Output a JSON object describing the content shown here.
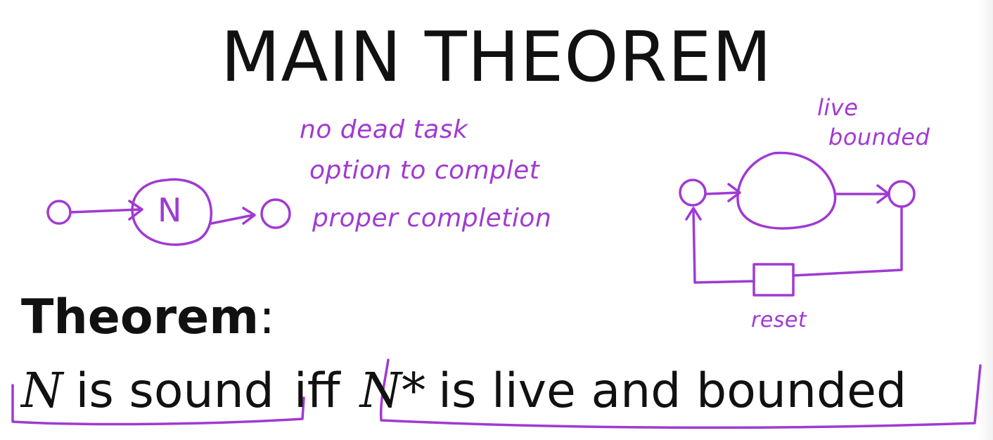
{
  "title": "MAIN THEOREM",
  "theorem": {
    "heading": "Theorem",
    "colon": ":",
    "net_symbol": "N",
    "is_sound": "is sound",
    "iff": "iff",
    "star_net_symbol": "N*",
    "is_live_bounded": "is live and bounded"
  },
  "notes": {
    "no_dead_tasks": "no dead task",
    "option_to_complete": "option to complet",
    "proper_completion": "proper completion",
    "live": "live",
    "bounded": "bounded",
    "reset": "reset",
    "net_label": "N"
  },
  "colors": {
    "ink": "#111111",
    "annotation": "#a03ad2"
  }
}
